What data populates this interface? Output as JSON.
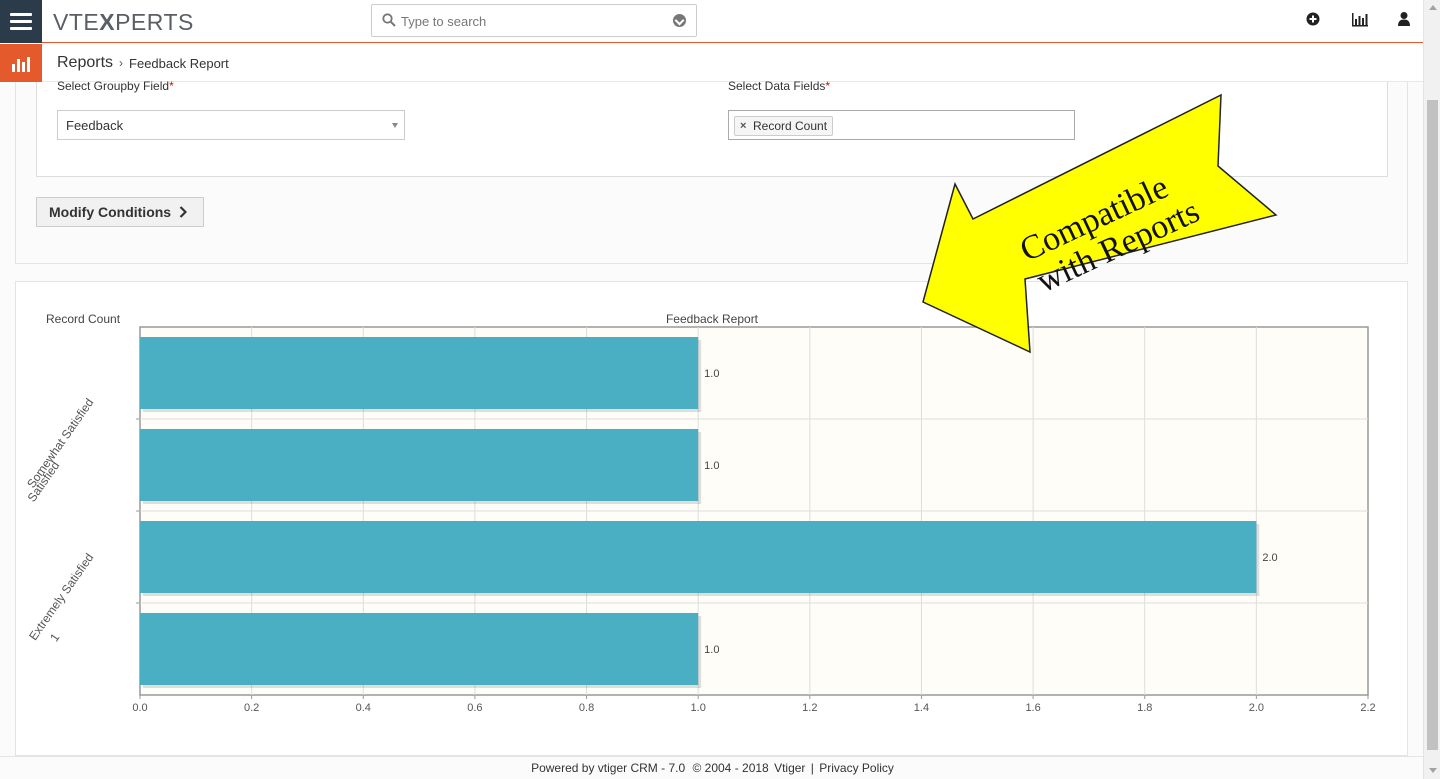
{
  "header": {
    "logo_prefix": "VTE",
    "logo_suffix": "PERTS",
    "logo_x": "X",
    "search_placeholder": "Type to search"
  },
  "breadcrumb": {
    "module": "Reports",
    "page": "Feedback Report"
  },
  "filters": {
    "groupby_label": "Select Groupby Field",
    "groupby_value": "Feedback",
    "datafields_label": "Select Data Fields",
    "datafields_tag": "Record Count",
    "required_mark": "*",
    "modify_label": "Modify Conditions"
  },
  "callout": {
    "line1": "Compatible",
    "line2": "with Reports",
    "color": "#ffff00"
  },
  "chart_data": {
    "type": "bar",
    "orientation": "horizontal",
    "title": "Feedback Report",
    "ylabel": "Record Count",
    "category_labels": [
      "Somewhat Satisfied",
      "Satisfied",
      "Extremely Satisfied",
      "1"
    ],
    "values": [
      1.0,
      1.0,
      2.0,
      1.0
    ],
    "value_labels": [
      "1.0",
      "1.0",
      "2.0",
      "1.0"
    ],
    "x_ticks": [
      "0.0",
      "0.2",
      "0.4",
      "0.6",
      "0.8",
      "1.0",
      "1.2",
      "1.4",
      "1.6",
      "1.8",
      "2.0",
      "2.2"
    ],
    "xlim": [
      0,
      2.2
    ],
    "bar_color": "#4bafc4",
    "plot_bg": "#fffdf7",
    "grid": true
  },
  "footer": {
    "powered": "Powered by vtiger CRM - 7.0",
    "copyright": "© 2004 - 2018",
    "vtiger": "Vtiger",
    "separator": "|",
    "privacy": "Privacy Policy"
  }
}
